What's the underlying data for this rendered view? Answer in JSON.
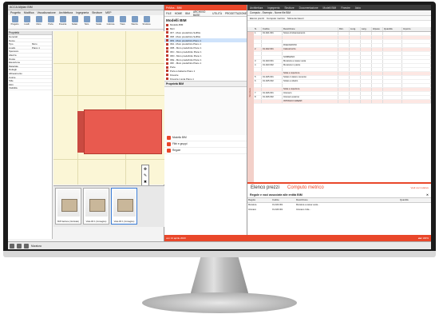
{
  "app1": {
    "title": "ACCA Allplan BIM",
    "ribbon_tabs": [
      "Progetto",
      "Modifica",
      "Visualizzazione",
      "Architettura",
      "Ingegneria",
      "Strutture",
      "MEP"
    ],
    "ribbon_buttons": [
      "Progetto",
      "Livelli",
      "Muro",
      "Porta",
      "Finestra",
      "Solaio",
      "Tetto",
      "Scala",
      "Colonna",
      "Trave",
      "Stanza",
      "Struttura"
    ],
    "props_header": "Proprietà",
    "props": [
      [
        "Generali",
        ""
      ],
      [
        "Nome",
        ""
      ],
      [
        "Tipo",
        "Muro"
      ],
      [
        "Livello",
        "Piano 1"
      ],
      [
        "Spessore",
        ""
      ],
      [
        "Altezza",
        ""
      ],
      [
        "Quota",
        ""
      ],
      [
        "Elevazione",
        ""
      ],
      [
        "Materiale",
        ""
      ],
      [
        "Dettagli",
        ""
      ],
      [
        "Allineamento",
        ""
      ],
      [
        "Colore",
        ""
      ],
      [
        "Stile",
        ""
      ],
      [
        "Filtri",
        ""
      ],
      [
        "Visibilità",
        ""
      ]
    ],
    "thumbs": [
      "B-B Sezione (Verticale)",
      "Vista 3D 1 (Immagine)",
      "Vista 3D 1 (Immagine)"
    ],
    "status_left": "Barra Comandi",
    "floating_tools": [
      "✥",
      "✎",
      "✖",
      "⤢",
      "▣"
    ]
  },
  "app2": {
    "header": "PriMus - BIM",
    "tabs": [
      "FILE",
      "HOME",
      "BIM",
      "ARCHIVIO BASE",
      "UTILITÀ",
      "PROGETTAZIONE"
    ],
    "title": "Modelli BIM",
    "tree": [
      {
        "label": "Modello-BIM",
        "sel": false
      },
      {
        "label": "Muri",
        "sel": false
      },
      {
        "label": "3F7 - Muro predefinito  Soffitto",
        "sel": false
      },
      {
        "label": "3F8 - Muro predefinito  Soffitto",
        "sel": false
      },
      {
        "label": "3F9 - Muro predefinito  Piano 1",
        "sel": true
      },
      {
        "label": "3FA - Muro predefinito  Piano 1",
        "sel": false
      },
      {
        "label": "3FB - Muro predefinito  Piano 1",
        "sel": false
      },
      {
        "label": "3FC - Muro predefinito  Piano 1",
        "sel": false
      },
      {
        "label": "3FD - Muro predefinito  Piano 1",
        "sel": false
      },
      {
        "label": "3FE - Muro predefinito  Piano 1",
        "sel": false
      },
      {
        "label": "3FF - Muro predefinito  Piano 1",
        "sel": false
      },
      {
        "label": "Porte",
        "sel": false
      },
      {
        "label": "Porta a battente  Piano 1",
        "sel": false
      },
      {
        "label": "Finestre",
        "sel": false
      },
      {
        "label": "Finestra 1 anta  Piano 1",
        "sel": false
      }
    ],
    "props_title": "Proprietà BIM",
    "nav": [
      "Modello BIM",
      "Filtri e gruppi",
      "Regole"
    ],
    "status": "ven 14 aprile 2023"
  },
  "app3": {
    "tabs": [
      "Architettura",
      "Ingegneria",
      "Strutture",
      "Documentazione",
      "Modelli BIM",
      "Finestre",
      "Aiuto"
    ],
    "ribbon": [
      "Computo - Esempio - Nome file BIM"
    ],
    "subtabs": [
      "Elenco prezzi",
      "Computo metrico",
      "Stima dei lavori"
    ],
    "columns": [
      "N.",
      "Codice",
      "Descrizione",
      "Dim.",
      "Lung.",
      "Larg.",
      "H/peso",
      "Quantità",
      "Importo"
    ],
    "category": "Strutture",
    "rows": [
      {
        "n": "1",
        "code": "01.A01.001",
        "desc": "Scavo di sbancamento",
        "qty": "",
        "amount": "",
        "band": false
      },
      {
        "n": "",
        "code": "",
        "desc": "",
        "qty": "",
        "amount": "",
        "band": true
      },
      {
        "n": "",
        "code": "",
        "desc": "",
        "qty": "",
        "amount": "",
        "band": false
      },
      {
        "n": "",
        "code": "",
        "desc": "RILEVAZIONI",
        "qty": "",
        "amount": "",
        "band": false
      },
      {
        "n": "2",
        "code": "01.A02.001",
        "desc": "Calcestruzzo",
        "qty": "",
        "amount": "",
        "band": true
      },
      {
        "n": "",
        "code": "",
        "desc": "",
        "qty": "",
        "amount": "",
        "band": false
      },
      {
        "n": "",
        "code": "",
        "desc": "SOMMANO",
        "qty": "",
        "amount": "",
        "band": false
      },
      {
        "n": "3",
        "code": "01.A03.001",
        "desc": "Muratura a cassa vuota",
        "qty": "",
        "amount": "",
        "band": false
      },
      {
        "n": "4",
        "code": "01.A03.002",
        "desc": "Muratura in pietra",
        "qty": "",
        "amount": "",
        "band": false
      },
      {
        "n": "",
        "code": "",
        "desc": "",
        "qty": "",
        "amount": "",
        "band": false
      },
      {
        "n": "",
        "code": "",
        "desc": "Solai e coperture",
        "qty": "",
        "amount": "",
        "band": true
      },
      {
        "n": "5",
        "code": "01.A05.001",
        "desc": "Solaio in latero cemento",
        "qty": "",
        "amount": "",
        "band": false
      },
      {
        "n": "6",
        "code": "01.A05.002",
        "desc": "Solaio a sbalzo",
        "qty": "",
        "amount": "",
        "band": false
      },
      {
        "n": "",
        "code": "",
        "desc": "",
        "qty": "",
        "amount": "",
        "band": false
      },
      {
        "n": "",
        "code": "",
        "desc": "Solai e coperture",
        "qty": "",
        "amount": "",
        "band": true
      },
      {
        "n": "7",
        "code": "01.A06.001",
        "desc": "Intonaco",
        "qty": "",
        "amount": "",
        "band": false
      },
      {
        "n": "8",
        "code": "01.A06.002",
        "desc": "Intonaco esterno",
        "qty": "",
        "amount": "",
        "band": false
      },
      {
        "n": "",
        "code": "",
        "desc": "INTONACI GREZZI",
        "qty": "",
        "amount": "",
        "band": true
      }
    ],
    "bottom_tabs": [
      "Elenco prezzi",
      "Computo metrico"
    ],
    "bottom_link": "Vedi voci relative",
    "rules_title": "Regole e voci associate alle entità BIM",
    "rules_cols": [
      "Regola",
      "Codice",
      "Descrizione",
      "Quantità"
    ],
    "rules": [
      [
        "Muratura",
        "01.A03.001",
        "Muratura a cassa vuota...",
        ""
      ],
      [
        "Intonaco",
        "01.A06.001",
        "Intonaco civile...",
        ""
      ]
    ]
  },
  "taskbar": {
    "label": "Muratura"
  },
  "colors": {
    "accent": "#e9472a",
    "building": "#e85a4f"
  }
}
